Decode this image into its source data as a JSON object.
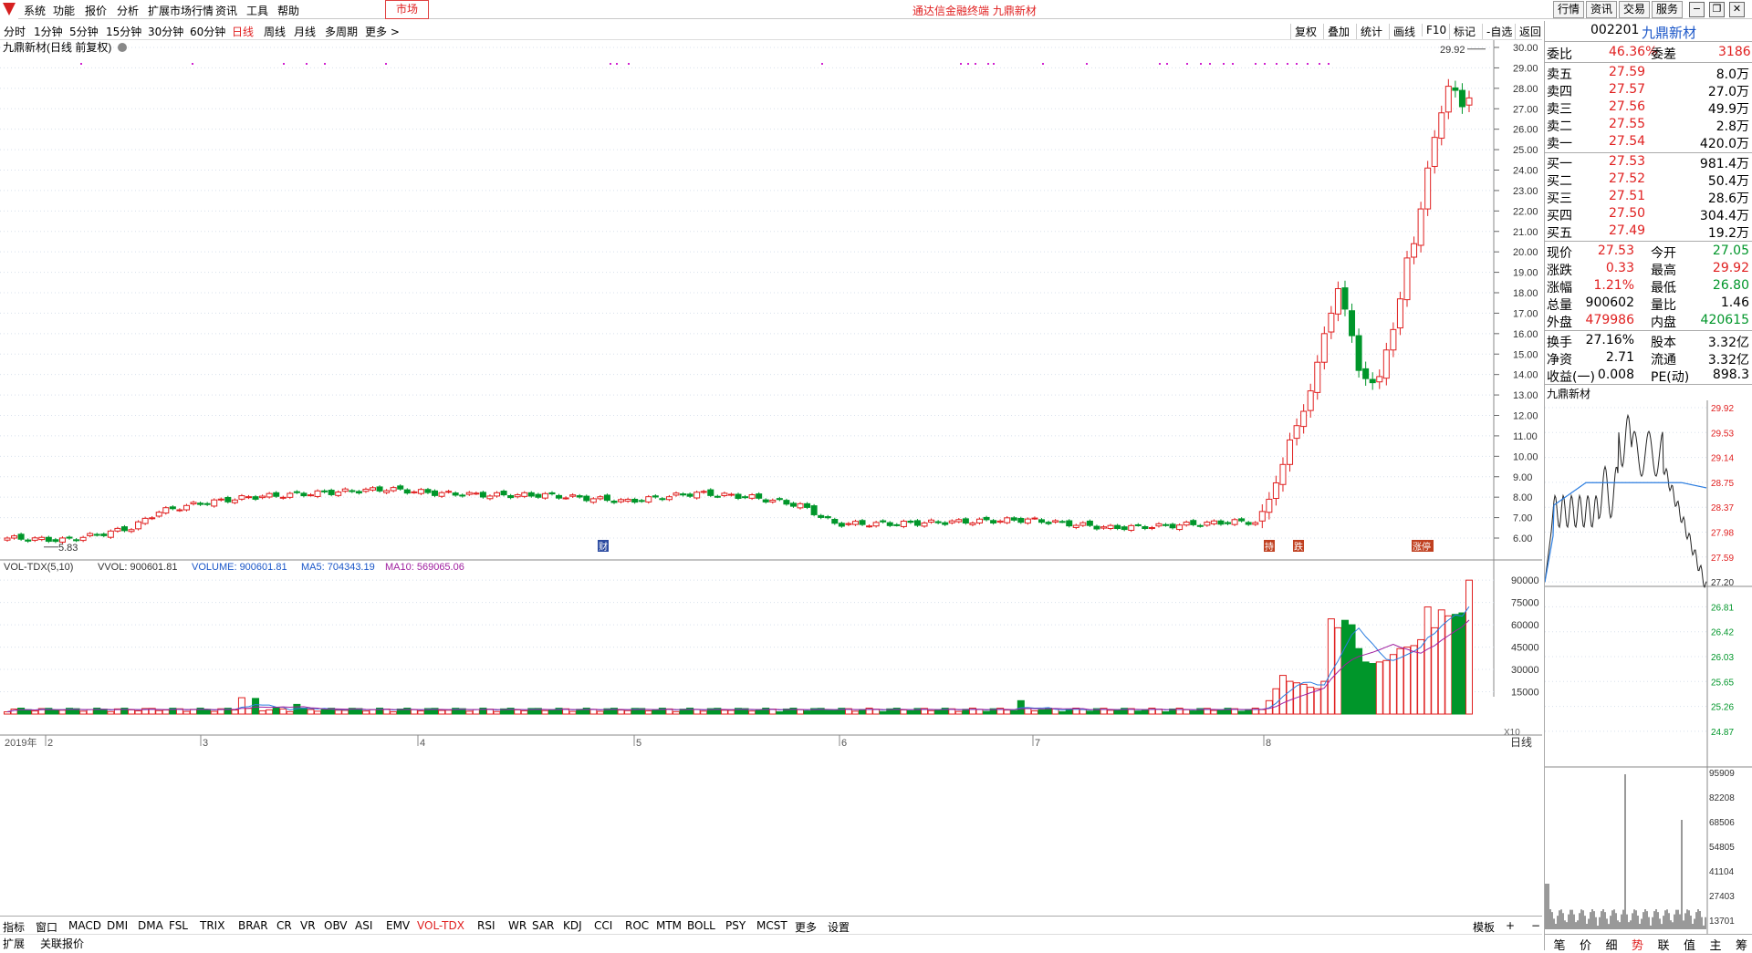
{
  "menu": {
    "items": [
      "系统",
      "功能",
      "报价",
      "分析",
      "扩展市场行情",
      "资讯",
      "工具",
      "帮助"
    ],
    "market": "市场",
    "title": "通达信金融终端  九鼎新材",
    "buttons": [
      "行情",
      "资讯",
      "交易",
      "服务"
    ]
  },
  "period": {
    "items": [
      "分时",
      "1分钟",
      "5分钟",
      "15分钟",
      "30分钟",
      "60分钟",
      "日线",
      "周线",
      "月线",
      "多周期",
      "更多 >"
    ],
    "active": "日线",
    "tools": [
      "复权",
      "叠加",
      "统计",
      "画线",
      "F10",
      "标记",
      "-自选",
      "返回"
    ]
  },
  "chart_title": "九鼎新材(日线 前复权)",
  "chart": {
    "price_ticks": [
      "30.00",
      "29.00",
      "28.00",
      "27.00",
      "26.00",
      "25.00",
      "24.00",
      "23.00",
      "22.00",
      "21.00",
      "20.00",
      "19.00",
      "18.00",
      "17.00",
      "16.00",
      "15.00",
      "14.00",
      "13.00",
      "12.00",
      "11.00",
      "10.00",
      "9.00",
      "8.00",
      "7.00",
      "6.00"
    ],
    "high_label": "29.92",
    "low_label": "5.83",
    "month_labels": [
      "2019年",
      "2",
      "3",
      "4",
      "5",
      "6",
      "7",
      "8"
    ],
    "event_markers": [
      "财",
      "持",
      "跌",
      "涨停"
    ],
    "vol_header": {
      "name": "VOL-TDX(5,10)",
      "vvol": "VVOL: 900601.81",
      "volume": "VOLUME: 900601.81",
      "ma5": "MA5: 704343.19",
      "ma10": "MA10: 569065.06"
    },
    "vol_ticks": [
      "90000",
      "75000",
      "60000",
      "45000",
      "30000",
      "15000"
    ],
    "vol_unit": "X10",
    "colors": {
      "up": "#e02020",
      "down": "#00962a",
      "ma5": "#2b7de0",
      "ma10": "#a020a0",
      "grid": "#d8e0ec"
    }
  },
  "chart_data": {
    "type": "candlestick",
    "x": [
      "2019-01",
      "2019-02",
      "2019-03",
      "2019-04",
      "2019-05",
      "2019-06",
      "2019-07",
      "2019-08"
    ],
    "ylim": [
      5.5,
      30.2
    ],
    "high": 29.92,
    "low": 5.83,
    "last_close": 27.53,
    "volume_ylim": [
      0,
      95000
    ]
  },
  "indicators": [
    "指标",
    "窗口",
    "MACD",
    "DMI",
    "DMA",
    "FSL",
    "TRIX",
    "BRAR",
    "CR",
    "VR",
    "OBV",
    "ASI",
    "EMV",
    "VOL-TDX",
    "RSI",
    "WR",
    "SAR",
    "KDJ",
    "CCI",
    "ROC",
    "MTM",
    "BOLL",
    "PSY",
    "MCST",
    "更多",
    "设置"
  ],
  "indicator_active": "VOL-TDX",
  "indicator_right": [
    "模板",
    "+",
    "−"
  ],
  "status": [
    "扩展",
    "关联报价"
  ],
  "quote": {
    "code": "002201",
    "name": "九鼎新材",
    "weibi": {
      "label": "委比",
      "value": "46.36%",
      "label2": "委差",
      "value2": "3186"
    },
    "asks": [
      {
        "label": "卖五",
        "price": "27.59",
        "vol": "8.0万"
      },
      {
        "label": "卖四",
        "price": "27.57",
        "vol": "27.0万"
      },
      {
        "label": "卖三",
        "price": "27.56",
        "vol": "49.9万"
      },
      {
        "label": "卖二",
        "price": "27.55",
        "vol": "2.8万"
      },
      {
        "label": "卖一",
        "price": "27.54",
        "vol": "420.0万"
      }
    ],
    "bids": [
      {
        "label": "买一",
        "price": "27.53",
        "vol": "981.4万"
      },
      {
        "label": "买二",
        "price": "27.52",
        "vol": "50.4万"
      },
      {
        "label": "买三",
        "price": "27.51",
        "vol": "28.6万"
      },
      {
        "label": "买四",
        "price": "27.50",
        "vol": "304.4万"
      },
      {
        "label": "买五",
        "price": "27.49",
        "vol": "19.2万"
      }
    ],
    "stats": [
      {
        "l": "现价",
        "v": "27.53",
        "l2": "今开",
        "v2": "27.05"
      },
      {
        "l": "涨跌",
        "v": "0.33",
        "l2": "最高",
        "v2": "29.92"
      },
      {
        "l": "涨幅",
        "v": "1.21%",
        "l2": "最低",
        "v2": "26.80"
      },
      {
        "l": "总量",
        "v": "900602",
        "l2": "量比",
        "v2": "1.46"
      },
      {
        "l": "外盘",
        "v": "479986",
        "l2": "内盘",
        "v2": "420615"
      }
    ],
    "fin": [
      {
        "l": "换手",
        "v": "27.16%",
        "l2": "股本",
        "v2": "3.32亿"
      },
      {
        "l": "净资",
        "v": "2.71",
        "l2": "流通",
        "v2": "3.32亿"
      },
      {
        "l": "收益(一)",
        "v": "0.008",
        "l2": "PE(动)",
        "v2": "898.3"
      }
    ],
    "mini_title": "九鼎新材",
    "mini_ticks": [
      "29.92",
      "29.53",
      "29.14",
      "28.75",
      "28.37",
      "27.98",
      "27.59",
      "27.20",
      "26.81",
      "26.42",
      "26.03",
      "25.65",
      "25.26",
      "24.87"
    ],
    "mini_vol_ticks": [
      "95909",
      "82208",
      "68506",
      "54805",
      "41104",
      "27403",
      "13701"
    ],
    "tabs": [
      "笔",
      "价",
      "细",
      "势",
      "联",
      "值",
      "主",
      "筹"
    ],
    "tab_active": "势"
  }
}
